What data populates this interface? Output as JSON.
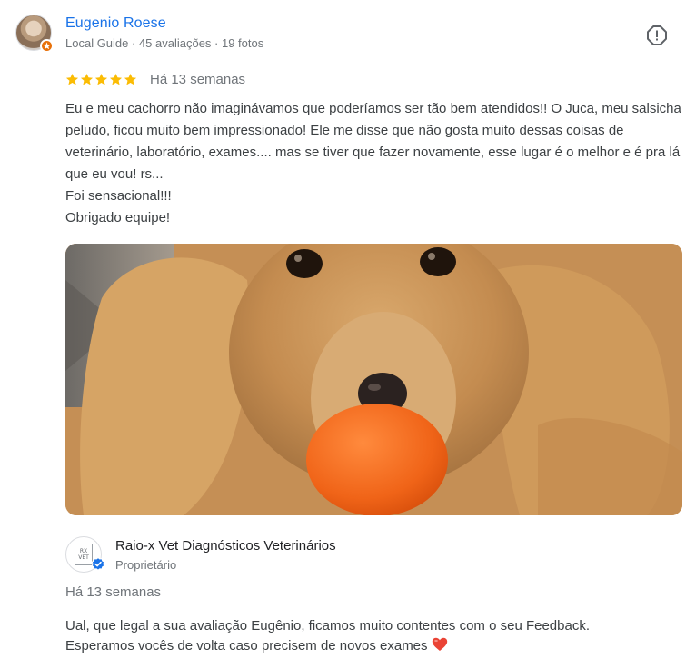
{
  "review": {
    "reviewer": {
      "name": "Eugenio Roese",
      "meta": "Local Guide · 45 avaliações · 19 fotos",
      "badge_icon": "local-guide-star-icon"
    },
    "rating": 5,
    "date": "Há 13 semanas",
    "text_lines": [
      "Eu e meu cachorro não imaginávamos que poderíamos ser tão bem atendidos!! O Juca, meu salsicha peludo, ficou muito bem impressionado! Ele me disse que não gosta muito dessas coisas de veterinário, laboratório, exames.... mas se tiver que fazer novamente, esse lugar é o melhor e é pra lá que eu vou! rs...",
      "Foi sensacional!!!",
      "Obrigado equipe!"
    ],
    "report_icon": "report-icon",
    "photo": {
      "subject": "dog-with-orange-ball-photo"
    }
  },
  "owner_response": {
    "business_name": "Raio-x Vet Diagnósticos Veterinários",
    "role": "Proprietário",
    "logo_text_top": "RX",
    "logo_text_bottom": "VET",
    "verified_icon": "verified-check-icon",
    "date": "Há 13 semanas",
    "text_line1": "Ual, que legal a sua avaliação Eugênio, ficamos muito contentes com o seu Feedback.",
    "text_line2": "Esperamos vocês de volta caso precisem de novos exames",
    "heart_icon": "heart-emoji-icon"
  },
  "colors": {
    "link_blue": "#1a73e8",
    "star_yellow": "#fbbc04",
    "meta_gray": "#70757a",
    "badge_orange": "#e8710a",
    "verified_blue": "#1a73e8",
    "heart_red": "#ea4335"
  }
}
